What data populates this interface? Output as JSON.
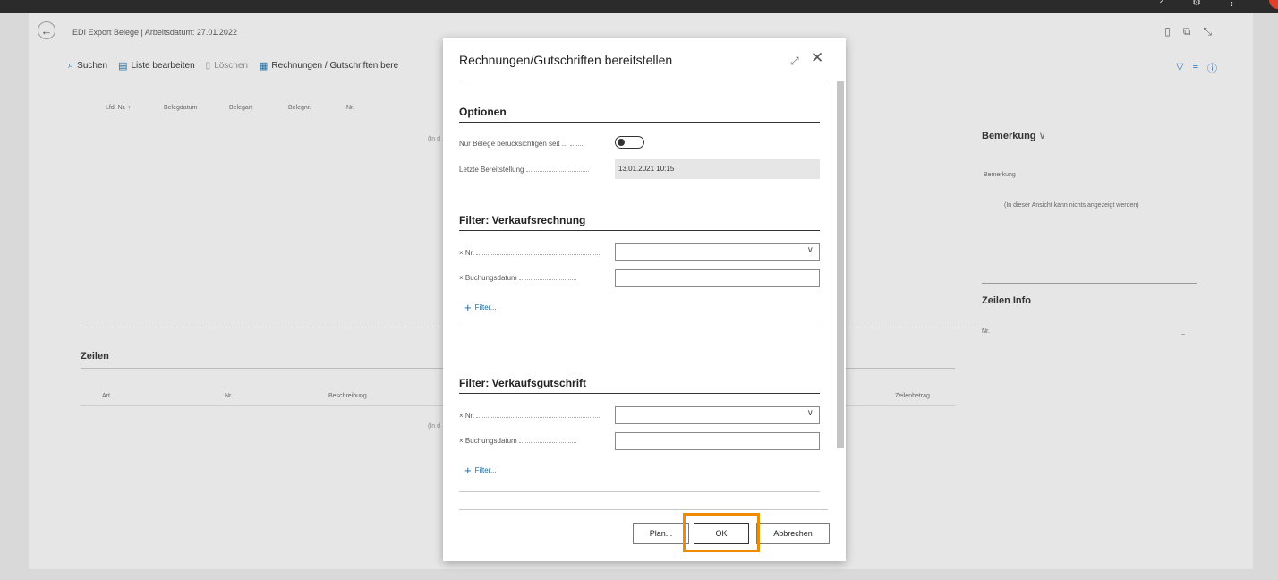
{
  "page": {
    "title": "EDI Export Belege | Arbeitsdatum: 27.01.2022",
    "actions": {
      "search": "Suchen",
      "edit_list": "Liste bearbeiten",
      "delete": "Löschen",
      "provide": "Rechnungen / Gutschriften bere"
    },
    "header_columns": [
      "Lfd. Nr. ↑",
      "Belegdatum",
      "Belegart",
      "Belegnr.",
      "Nr."
    ],
    "empty_hint_fragment": "(In d",
    "lines": {
      "title": "Zeilen",
      "columns": [
        "Art",
        "Nr.",
        "Beschreibung"
      ],
      "amount_column": "Zeilenbetrag",
      "empty_hint_fragment": "(In d"
    }
  },
  "factbox": {
    "remark_title": "Bemerkung",
    "remark_field": "Bemerkung",
    "remark_empty": "(In dieser Ansicht kann nichts angezeigt werden)",
    "lines_info_title": "Zeilen Info",
    "lines_info_nr": "Nr.",
    "lines_info_nr_value": "_"
  },
  "dialog": {
    "title": "Rechnungen/Gutschriften bereitstellen",
    "options": {
      "title": "Optionen",
      "only_since_label": "Nur Belege berücksichtigen seit ...",
      "only_since_on": false,
      "last_provision_label": "Letzte Bereitstellung",
      "last_provision_value": "13.01.2021 10:15"
    },
    "filter_invoice": {
      "title": "Filter: Verkaufsrechnung",
      "nr_label": "Nr.",
      "posting_date_label": "Buchungsdatum",
      "add_filter": "Filter..."
    },
    "filter_credit": {
      "title": "Filter: Verkaufsgutschrift",
      "nr_label": "Nr.",
      "posting_date_label": "Buchungsdatum",
      "add_filter": "Filter..."
    },
    "buttons": {
      "plan": "Plan...",
      "ok": "OK",
      "cancel": "Abbrechen"
    }
  },
  "colors": {
    "highlight": "#f08a00",
    "accent": "#1a6aa0"
  }
}
